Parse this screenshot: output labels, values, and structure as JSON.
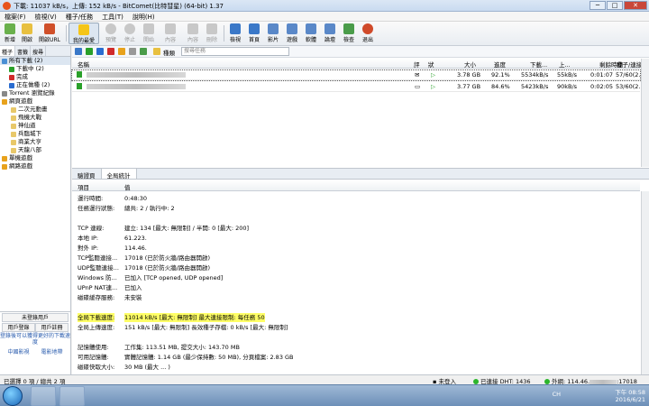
{
  "window": {
    "title": "下載: 11037 kB/s，上傳: 152 kB/s - BitComet(比特彗星) (64-bit) 1.37",
    "min": "─",
    "max": "□",
    "close": "✕"
  },
  "menu": [
    "檔案(F)",
    "檢視(V)",
    "種子/任務",
    "工具(T)",
    "說明(H)"
  ],
  "menu_items": {
    "file": "檔案(F)",
    "view": "檢視(V)",
    "tasks": "種子/任務",
    "tools": "工具(T)",
    "help": "說明(H)"
  },
  "toolbar": {
    "new": "新增",
    "open": "開啟",
    "open_url": "開啟URL",
    "favorites": "我的最愛",
    "preview": "預覽",
    "stop": "停止",
    "start": "開始",
    "props": "內容",
    "delete": "刪除",
    "grid": "檢視",
    "home": "首頁",
    "video": "影片",
    "game": "遊戲",
    "software": "軟體",
    "forum": "論壇",
    "check": "檢查",
    "exit": "退出",
    "search_label": "搜尋",
    "search_value": ""
  },
  "sidebar": {
    "tabs": [
      "種子",
      "書籤",
      "搜尋"
    ],
    "items": [
      {
        "label": "所有下載 (2)",
        "color": "#4a8fd4"
      },
      {
        "label": "下載中 (2)",
        "color": "#2aa02a"
      },
      {
        "label": "完成",
        "color": "#d02a2a"
      },
      {
        "label": "正在做種 (2)",
        "color": "#2a6cd0"
      },
      {
        "label": "Torrent 瀏覽紀錄",
        "color": "#888888"
      },
      {
        "label": "網頁遊戲",
        "color": "#e8a21c"
      },
      {
        "label": "二次元動畫",
        "color": "#e8c86a"
      },
      {
        "label": "飛機大戰",
        "color": "#e8c86a"
      },
      {
        "label": "神仙道",
        "color": "#e8c86a"
      },
      {
        "label": "兵臨城下",
        "color": "#e8c86a"
      },
      {
        "label": "商業大亨",
        "color": "#e8c86a"
      },
      {
        "label": "天龍八部",
        "color": "#e8c86a"
      },
      {
        "label": "單機遊戲",
        "color": "#e8a21c"
      },
      {
        "label": "網路遊戲",
        "color": "#e8a21c"
      }
    ],
    "login_button": "未登錄用戶",
    "user_login": "用戶登錄",
    "register": "用戶註冊",
    "login_hint": "登錄後可以獲得更好的下載速度",
    "link_left": "中國影視",
    "link_right": "電影地帶"
  },
  "filter_bar": {
    "label": "種類",
    "search_placeholder": "搜尋任務"
  },
  "table": {
    "columns": [
      "名稱",
      "評",
      "狀",
      "大小",
      "進度",
      "下載...",
      "上...",
      "剩餘時間",
      "種子/連接"
    ],
    "rows": [
      {
        "name": "",
        "size": "3.78 GB",
        "progress": "92.1%",
        "down": "5534kB/s",
        "up": "55kB/s",
        "eta": "0:01:07",
        "seeds": "57/60(2..."
      },
      {
        "name": "",
        "size": "3.77 GB",
        "progress": "84.6%",
        "down": "5423kB/s",
        "up": "90kB/s",
        "eta": "0:02:05",
        "seeds": "53/60(2..."
      }
    ]
  },
  "lower_tabs": [
    "驗證頁",
    "全局統計"
  ],
  "stats": {
    "col_item": "項目",
    "col_value": "值",
    "rows": [
      {
        "k": "運行時間:",
        "v": "0:48:30"
      },
      {
        "k": "任務運行狀態:",
        "v": "總共: 2 / 執行中: 2"
      },
      {
        "k": "",
        "v": ""
      },
      {
        "k": "TCP 連線:",
        "v": "建立: 134 [最大: 無限制] / 半開: 0 [最大: 200]"
      },
      {
        "k": "本地 IP:",
        "v": "61.223."
      },
      {
        "k": "對外 IP:",
        "v": "114.46."
      },
      {
        "k": "TCP監聽連接...",
        "v": "17018 (已於防火牆/路由器開啟)"
      },
      {
        "k": "UDP監聽連接...",
        "v": "17018 (已於防火牆/路由器開啟)"
      },
      {
        "k": "Windows 防...",
        "v": "已加入 [TCP opened, UDP opened]"
      },
      {
        "k": "UPnP NAT連...",
        "v": "已加入"
      },
      {
        "k": "磁碟緩存服務:",
        "v": "未安裝"
      },
      {
        "k": "",
        "v": ""
      },
      {
        "k": "全局下載速度:",
        "v": "11014 kB/s [最大: 無限制]    最大連接限制: 每任務 50",
        "hl": true
      },
      {
        "k": "全局上傳速度:",
        "v": "151 kB/s [最大: 無限制]    長效種子存檔: 0 kB/s [最大: 無限制]"
      },
      {
        "k": "",
        "v": ""
      },
      {
        "k": "記憶體使用:",
        "v": "工作集: 113.51 MB, 提交大小: 143.70 MB"
      },
      {
        "k": "可用記憶體:",
        "v": "實體記憶體: 1.14 GB (最少保持數: 50 MB), 分頁檔案: 2.83 GB"
      },
      {
        "k": "磁碟快取大小:",
        "v": "30 MB (最大 ... )"
      }
    ]
  },
  "statusbar": {
    "left": "已選擇 0 項 / 總共 2 項",
    "dht_label": "未登入",
    "dht": "已連接 DHT: 1436",
    "ext_ip": "外網: 114.46.",
    "port": ":17018"
  },
  "taskbar": {
    "time": "下午 08:58",
    "date": "2016/6/21",
    "lang": "CH"
  }
}
